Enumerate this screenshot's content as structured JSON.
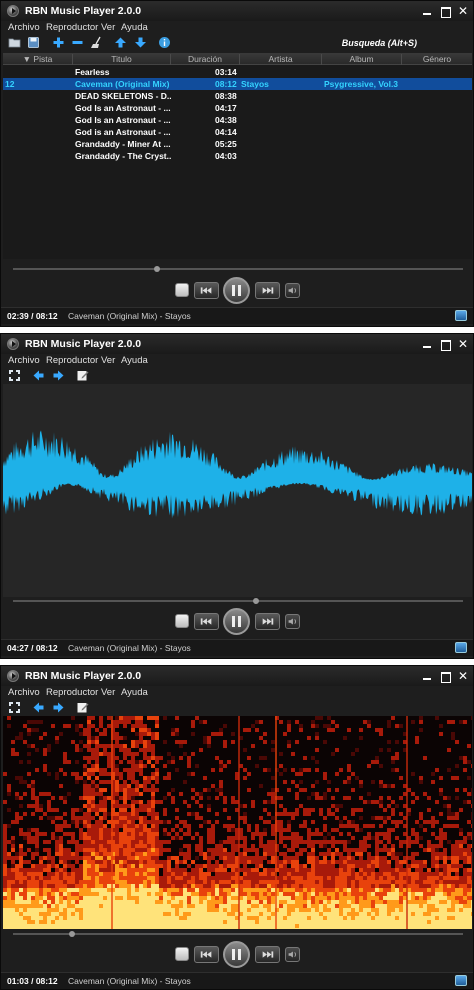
{
  "app": {
    "title": "RBN Music Player 2.0.0",
    "close_glyph": "✕",
    "menus": [
      "Archivo",
      "Reproductor",
      "Ver",
      "Ayuda"
    ]
  },
  "colors": {
    "waveform": "#1eb1e8",
    "selected_row_bg": "#114d9c",
    "selected_row_text": "#34d3ff"
  },
  "icons": {
    "toolbar_playlist": [
      "folder-open-icon",
      "save-icon",
      "add-icon",
      "remove-icon",
      "broom-icon",
      "move-up-icon",
      "move-down-icon",
      "info-icon"
    ],
    "toolbar_viz": [
      "fullscreen-icon",
      "back-icon",
      "forward-icon",
      "edit-icon"
    ],
    "controls": [
      "stop-icon",
      "previous-icon",
      "pause-icon",
      "next-icon",
      "volume-icon"
    ]
  },
  "search": {
    "label": "Busqueda  (Alt+S)"
  },
  "playlist": {
    "columns": [
      "▼ Pista",
      "Titulo",
      "Duración",
      "Artista",
      "Album",
      "Género"
    ],
    "rows": [
      {
        "pista": "",
        "titulo": "Fearless",
        "duracion": "03:14",
        "artista": "",
        "album": "",
        "genero": ""
      },
      {
        "pista": "12",
        "titulo": "Caveman (Original Mix)",
        "duracion": "08:12",
        "artista": "Stayos",
        "album": "Psygressive, Vol.3",
        "genero": "",
        "selected": true
      },
      {
        "pista": "",
        "titulo": "DEAD SKELETONS - D...",
        "duracion": "08:38",
        "artista": "",
        "album": "",
        "genero": ""
      },
      {
        "pista": "",
        "titulo": "God Is an Astronaut - ...",
        "duracion": "04:17",
        "artista": "",
        "album": "",
        "genero": ""
      },
      {
        "pista": "",
        "titulo": "God Is an Astronaut - ...",
        "duracion": "04:38",
        "artista": "",
        "album": "",
        "genero": ""
      },
      {
        "pista": "",
        "titulo": "God is an Astronaut - ...",
        "duracion": "04:14",
        "artista": "",
        "album": "",
        "genero": ""
      },
      {
        "pista": "",
        "titulo": "Grandaddy - Miner At ...",
        "duracion": "05:25",
        "artista": "",
        "album": "",
        "genero": ""
      },
      {
        "pista": "",
        "titulo": "Grandaddy - The Cryst...",
        "duracion": "04:03",
        "artista": "",
        "album": "",
        "genero": ""
      }
    ]
  },
  "windows": [
    {
      "view": "playlist",
      "status_time": "02:39 / 08:12",
      "status_track": "Caveman (Original Mix) - Stayos",
      "progress": 0.32
    },
    {
      "view": "waveform",
      "status_time": "04:27 / 08:12",
      "status_track": "Caveman (Original Mix) - Stayos",
      "progress": 0.54
    },
    {
      "view": "spectrogram",
      "status_time": "01:03 / 08:12",
      "status_track": "Caveman (Original Mix) - Stayos",
      "progress": 0.13
    }
  ]
}
